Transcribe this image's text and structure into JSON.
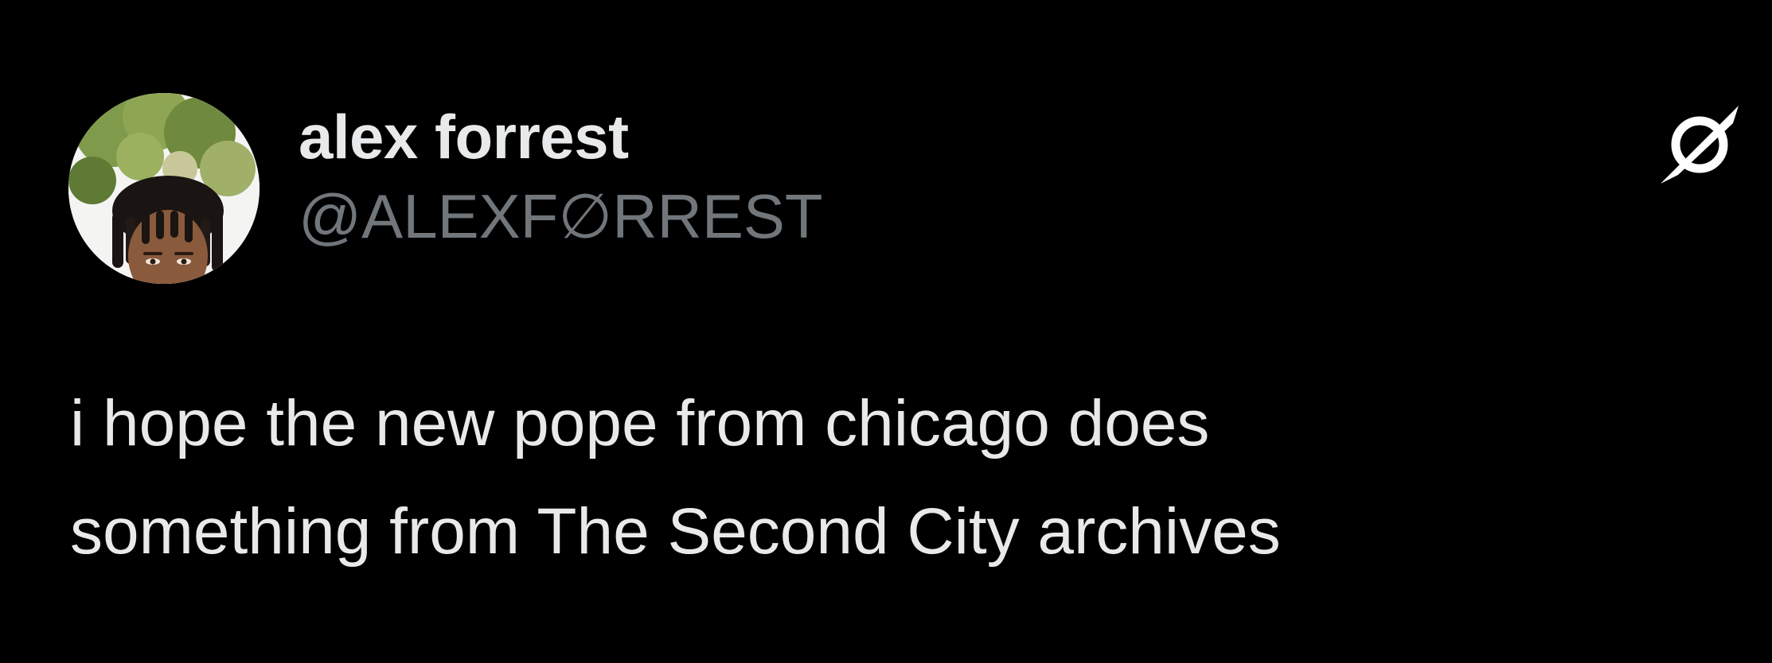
{
  "tweet": {
    "author": {
      "display_name": "alex forrest",
      "handle": "@ALEXF∅RREST"
    },
    "text_lines": [
      "i hope the new pope from chicago does",
      "something from The Second City archives"
    ],
    "logo_icon": "slashed-circle-icon"
  },
  "colors": {
    "background": "#000000",
    "primary_text": "#e7e9ea",
    "secondary_text": "#71767b"
  }
}
